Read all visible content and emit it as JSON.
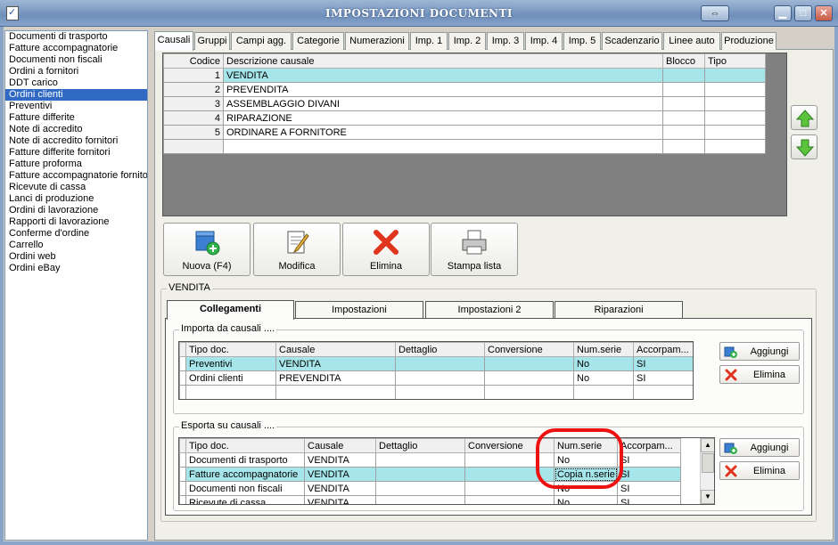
{
  "window": {
    "title": "IMPOSTAZIONI DOCUMENTI"
  },
  "doc_list": [
    "Documenti di trasporto",
    "Fatture accompagnatorie",
    "Documenti non fiscali",
    "Ordini a fornitori",
    "DDT carico",
    "Ordini clienti",
    "Preventivi",
    "Fatture differite",
    "Note di accredito",
    "Note di accredito fornitori",
    "Fatture differite fornitori",
    "Fatture proforma",
    "Fatture accompagnatorie fornito",
    "Ricevute di cassa",
    "Lanci di produzione",
    "Ordini di lavorazione",
    "Rapporti di lavorazione",
    "Conferme d'ordine",
    "Carrello",
    "Ordini web",
    "Ordini eBay"
  ],
  "doc_list_selected": "Ordini clienti",
  "main_tabs": [
    "Causali",
    "Gruppi",
    "Campi agg.",
    "Categorie",
    "Numerazioni",
    "Imp. 1",
    "Imp. 2",
    "Imp. 3",
    "Imp. 4",
    "Imp. 5",
    "Scadenzario",
    "Linee auto",
    "Produzione"
  ],
  "main_tab_active": "Causali",
  "causali_grid": {
    "headers": {
      "codice": "Codice",
      "descrizione": "Descrizione causale",
      "blocco": "Blocco",
      "tipo": "Tipo"
    },
    "rows": [
      {
        "codice": "1",
        "descrizione": "VENDITA",
        "blocco": "",
        "tipo": ""
      },
      {
        "codice": "2",
        "descrizione": "PREVENDITA",
        "blocco": "",
        "tipo": ""
      },
      {
        "codice": "3",
        "descrizione": "ASSEMBLAGGIO DIVANI",
        "blocco": "",
        "tipo": ""
      },
      {
        "codice": "4",
        "descrizione": "RIPARAZIONE",
        "blocco": "",
        "tipo": ""
      },
      {
        "codice": "5",
        "descrizione": "ORDINARE A FORNITORE",
        "blocco": "",
        "tipo": ""
      }
    ]
  },
  "actions": {
    "nuova": "Nuova (F4)",
    "modifica": "Modifica",
    "elimina": "Elimina",
    "stampa": "Stampa lista"
  },
  "detail_group": {
    "title": "VENDITA"
  },
  "sub_tabs": [
    "Collegamenti",
    "Impostazioni",
    "Impostazioni 2",
    "Riparazioni"
  ],
  "sub_tab_active": "Collegamenti",
  "importa": {
    "title": "Importa da causali ....",
    "headers": {
      "tipo": "Tipo doc.",
      "causale": "Causale",
      "dettaglio": "Dettaglio",
      "conversione": "Conversione",
      "numserie": "Num.serie",
      "accorpam": "Accorpam..."
    },
    "rows": [
      {
        "tipo": "Preventivi",
        "causale": "VENDITA",
        "dettaglio": "",
        "conversione": "",
        "numserie": "No",
        "accorpam": "SI"
      },
      {
        "tipo": "Ordini clienti",
        "causale": "PREVENDITA",
        "dettaglio": "",
        "conversione": "",
        "numserie": "No",
        "accorpam": "SI"
      }
    ],
    "add_label": "Aggiungi",
    "del_label": "Elimina"
  },
  "esporta": {
    "title": "Esporta su causali ....",
    "headers": {
      "tipo": "Tipo doc.",
      "causale": "Causale",
      "dettaglio": "Dettaglio",
      "conversione": "Conversione",
      "numserie": "Num.serie",
      "accorpam": "Accorpam..."
    },
    "rows": [
      {
        "tipo": "Documenti di trasporto",
        "causale": "VENDITA",
        "dettaglio": "",
        "conversione": "",
        "numserie": "No",
        "accorpam": "SI"
      },
      {
        "tipo": "Fatture accompagnatorie",
        "causale": "VENDITA",
        "dettaglio": "",
        "conversione": "",
        "numserie": "Copia n.serie",
        "accorpam": "SI"
      },
      {
        "tipo": "Documenti non fiscali",
        "causale": "VENDITA",
        "dettaglio": "",
        "conversione": "",
        "numserie": "No",
        "accorpam": "SI"
      },
      {
        "tipo": "Ricevute di cassa",
        "causale": "VENDITA",
        "dettaglio": "",
        "conversione": "",
        "numserie": "No",
        "accorpam": "SI"
      }
    ],
    "add_label": "Aggiungi",
    "del_label": "Elimina"
  },
  "colors": {
    "selection": "#316ac5",
    "row_highlight": "#a6e6ea",
    "annotation": "#e11111"
  }
}
